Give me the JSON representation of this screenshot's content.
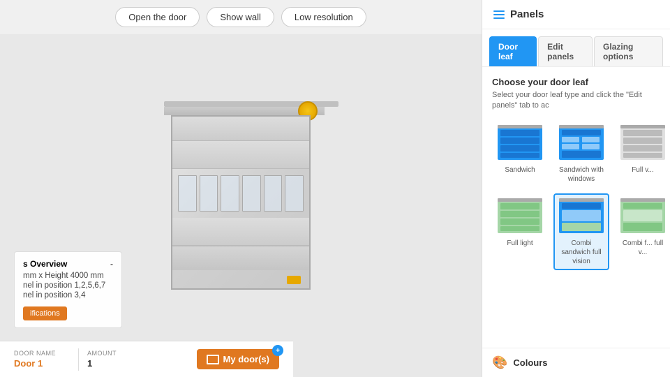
{
  "toolbar": {
    "open_door_label": "Open the door",
    "show_wall_label": "Show wall",
    "low_resolution_label": "Low resolution"
  },
  "info_overlay": {
    "title": "s Overview",
    "minus_label": "-",
    "line1": "mm x Height 4000 mm",
    "line2": "nel in position 1,2,5,6,7",
    "line3": "nel in position 3,4",
    "button_label": "ifications"
  },
  "bottom_bar": {
    "door_name_label": "DOOR NAME",
    "door_name_value": "Door 1",
    "amount_label": "AMOUNT",
    "amount_value": "1",
    "my_doors_label": "My door(s)",
    "badge_count": "+"
  },
  "right_panel": {
    "title": "Panels",
    "tabs": [
      {
        "id": "door-leaf",
        "label": "Door leaf",
        "active": true
      },
      {
        "id": "edit-panels",
        "label": "Edit panels",
        "active": false
      },
      {
        "id": "glazing-options",
        "label": "Glazing options",
        "active": false
      }
    ],
    "section_title": "Choose your door leaf",
    "section_subtitle": "Select your door leaf type and click the \"Edit panels\" tab to ac",
    "door_options": [
      {
        "id": "sandwich",
        "label": "Sandwich",
        "selected": false
      },
      {
        "id": "sandwich-windows",
        "label": "Sandwich with windows",
        "selected": false
      },
      {
        "id": "full-vision",
        "label": "Full v...",
        "selected": false
      },
      {
        "id": "full-light",
        "label": "Full light",
        "selected": false
      },
      {
        "id": "combi-sandwich-full-vision",
        "label": "Combi sandwich full vision",
        "selected": true
      },
      {
        "id": "combi-full-vision",
        "label": "Combi f... full v...",
        "selected": false
      }
    ],
    "colours_title": "Colours"
  }
}
